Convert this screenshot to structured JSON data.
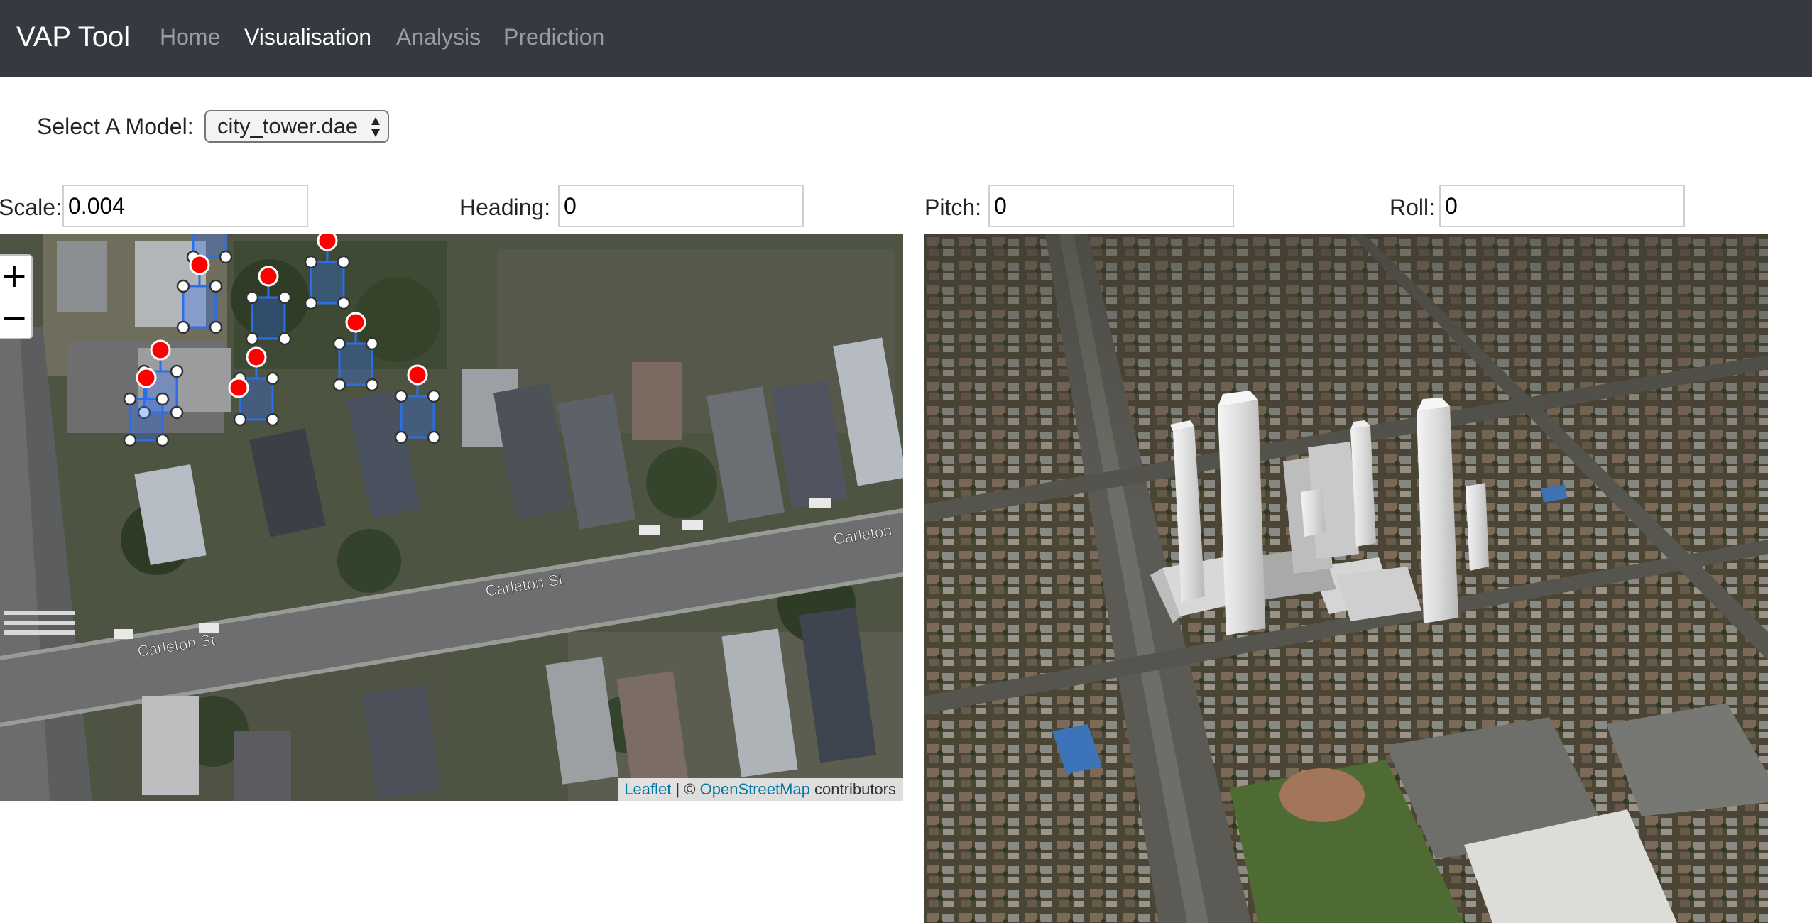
{
  "navbar": {
    "brand": "VAP Tool",
    "links": [
      {
        "label": "Home",
        "active": false
      },
      {
        "label": "Visualisation",
        "active": true
      },
      {
        "label": "Analysis",
        "active": false
      },
      {
        "label": "Prediction",
        "active": false
      }
    ]
  },
  "model": {
    "label": "Select A Model:",
    "selected": "city_tower.dae"
  },
  "params": {
    "scale_label": "Scale:",
    "scale_value": "0.004",
    "heading_label": "Heading:",
    "heading_value": "0",
    "pitch_label": "Pitch:",
    "pitch_value": "0",
    "roll_label": "Roll:",
    "roll_value": "0"
  },
  "map": {
    "zoom_in": "+",
    "zoom_out": "−",
    "street_labels": [
      "Carleton St",
      "Carleton St",
      "Carleton"
    ],
    "attribution": {
      "leaflet": "Leaflet",
      "separator": " | © ",
      "osm": "OpenStreetMap",
      "contributors": " contributors"
    },
    "icons": [
      "marker-icon",
      "vertex-handle-icon"
    ]
  },
  "colors": {
    "navbar_bg": "#343a40",
    "building_outline": "#2a6ee8",
    "marker": "#ff0000"
  }
}
